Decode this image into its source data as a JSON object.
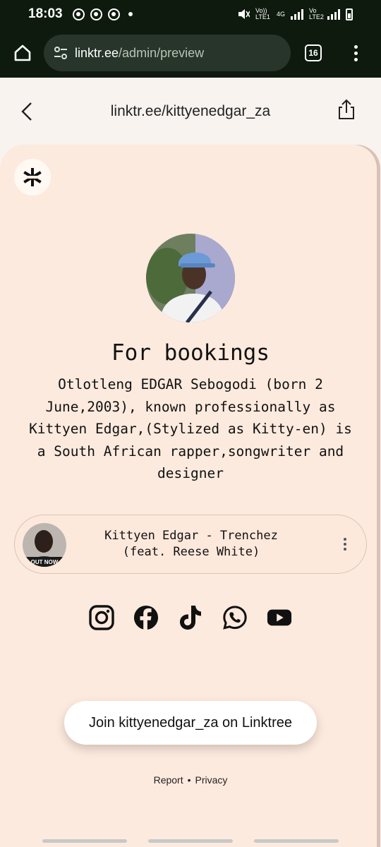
{
  "status_bar": {
    "time": "18:03",
    "indicators": [
      "chrome-icon",
      "chrome-icon",
      "chrome-icon"
    ],
    "net1": "Vo)) LTE1",
    "net1_speed": "4G",
    "net2": "Vo LTE2"
  },
  "browser": {
    "url_host": "linktr.ee",
    "url_path": "/admin/preview",
    "tab_count": "16"
  },
  "header": {
    "page_url": "linktr.ee/kittyenedgar_za"
  },
  "profile": {
    "title": "For bookings",
    "bio": "Otlotleng EDGAR Sebogodi (born 2 June,2003), known professionally as Kittyen Edgar,(Stylized as Kitty-en) is a South African rapper,songwriter and designer"
  },
  "music": {
    "title_line1": "Kittyen Edgar - Trenchez",
    "title_line2": "(feat. Reese White)",
    "thumb_text": "OUT NOW"
  },
  "socials": [
    "instagram-icon",
    "facebook-icon",
    "tiktok-icon",
    "whatsapp-icon",
    "youtube-icon"
  ],
  "join_button": "Join kittyenedgar_za on Linktree",
  "footer": {
    "report": "Report",
    "separator": "•",
    "privacy": "Privacy"
  },
  "colors": {
    "card_bg": "#fdeade",
    "browser_chrome": "#0e1a0e"
  }
}
